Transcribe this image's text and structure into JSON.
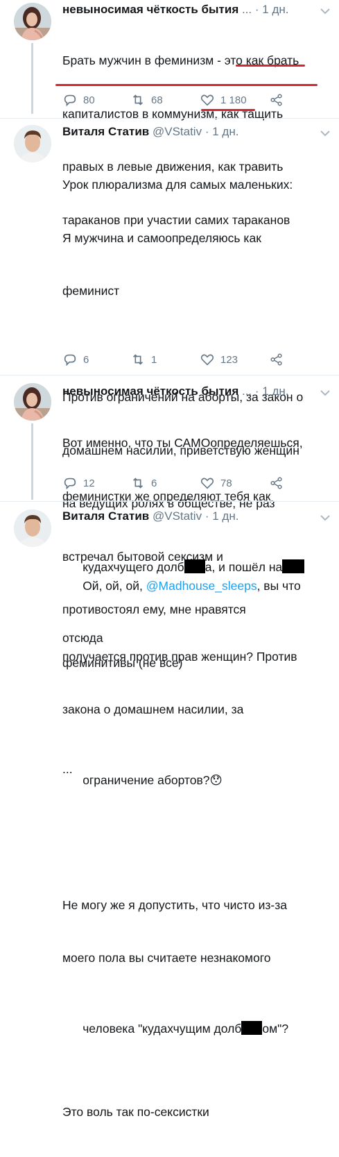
{
  "tweets": [
    {
      "name": "невыносимая чёткость бытия",
      "handle": "",
      "ellipsis": "...",
      "dot": "·",
      "time": "1 дн.",
      "lines": [
        "Брать мужчин в феминизм - это как брать",
        "капиталистов в коммунизм, как тащить",
        "правых в левые движения, как травить",
        "тараканов при участии самих тараканов"
      ],
      "replies": "80",
      "retweets": "68",
      "likes": "1 180"
    },
    {
      "name": "Виталя Статив",
      "handle": "@VStativ",
      "dot": "·",
      "time": "1 дн.",
      "lines": [
        "Урок плюрализма для самых маленьких:",
        "Я мужчина и самоопределяюсь как",
        "феминист",
        "",
        "Против ограничений на аборты, за закон о",
        "домашнем насилии, приветствую женщин",
        "на ведущих ролях в обществе, не раз",
        "встречал бытовой сексизм и",
        "противостоял ему, мне нравятся",
        "феминитивы (не все)",
        "",
        "..."
      ],
      "replies": "6",
      "retweets": "1",
      "likes": "123"
    },
    {
      "name": "невыносимая чёткость бытия",
      "ellipsis": "...",
      "dot": "·",
      "time": "1 дн.",
      "lines": [
        "Вот именно, что ты САМОопределяешься,",
        "феминистки же определяют тебя как"
      ],
      "line3_a": "кудахчущего долб",
      "line3_b": "а, и пошёл на",
      "line4": "отсюда",
      "replies": "12",
      "retweets": "6",
      "likes": "78"
    },
    {
      "name": "Виталя Статив",
      "handle": "@VStativ",
      "dot": "·",
      "time": "1 дн.",
      "line1_a": "Ой, ой, ой, ",
      "mention": "@Madhouse_sleeps",
      "line1_b": ", вы что",
      "lines": [
        "получается против прав женщин? Против",
        "закона о домашнем насилии, за",
        "ограничение абортов?"
      ],
      "emoji": "😯",
      "lines2": [
        "Не могу же я допустить, что чисто из-за",
        "моего пола вы считаете незнакомого"
      ],
      "last_a": "человека \"кудахчущим долб",
      "last_b": "ом\"?",
      "cut_line": "Это воль так по-сексистки"
    }
  ],
  "colors": {
    "accent": "#1da1f2",
    "muted": "#657786",
    "underline": "#d42630"
  },
  "icons": [
    "reply-icon",
    "retweet-icon",
    "like-icon",
    "share-icon",
    "chevron-down-icon"
  ]
}
